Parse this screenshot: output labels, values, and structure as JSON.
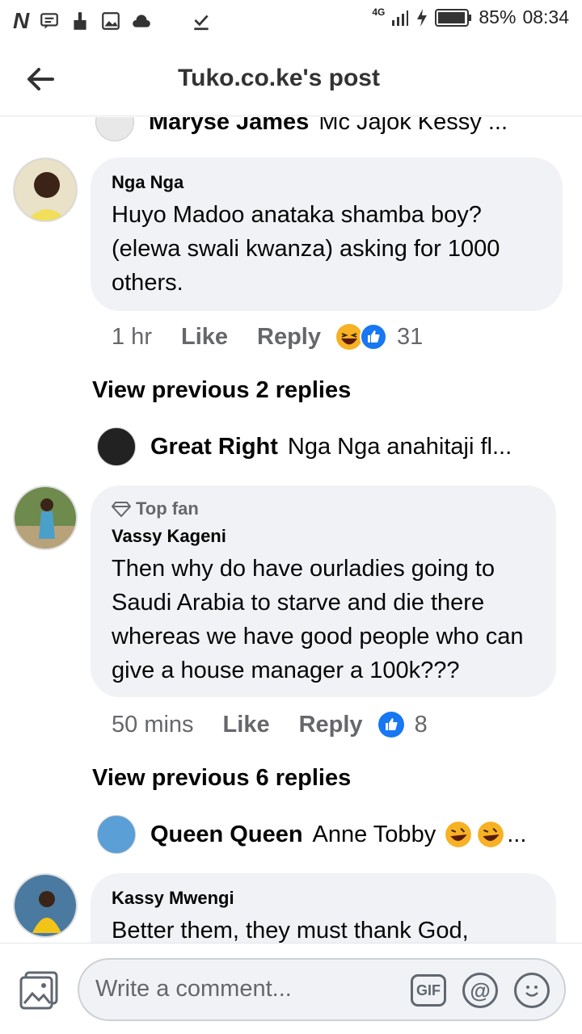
{
  "status_bar": {
    "network": "4G",
    "battery": "85%",
    "time": "08:34"
  },
  "header": {
    "title": "Tuko.co.ke's post"
  },
  "top_reply": {
    "name": "Maryse James",
    "preview": "Mc Jajok Kessy ..."
  },
  "comments": [
    {
      "author": "Nga Nga",
      "top_fan": false,
      "text": "Huyo Madoo anataka shamba boy? (elewa swali kwanza) asking for 1000 others.",
      "time": "1 hr",
      "like_label": "Like",
      "reply_label": "Reply",
      "reaction_count": "31",
      "reactions": [
        "haha-icon",
        "like-icon"
      ]
    },
    {
      "author": "Vassy Kageni",
      "top_fan": true,
      "top_fan_label": "Top fan",
      "text": "Then why  do have ourladies going to Saudi Arabia to starve and die there whereas we have good people who can give a house manager a 100k???",
      "time": "50 mins",
      "like_label": "Like",
      "reply_label": "Reply",
      "reaction_count": "8",
      "reactions": [
        "like-icon"
      ]
    },
    {
      "author": "Kassy Mwengi",
      "top_fan": false,
      "text": "Better them, they must thank God,"
    }
  ],
  "view_previous": [
    {
      "label": "View previous 2 replies"
    },
    {
      "label": "View previous 6 replies"
    }
  ],
  "reply_previews": [
    {
      "name": "Great Right",
      "preview": "Nga Nga anahitaji fl..."
    },
    {
      "name": "Queen Queen",
      "preview": "Anne Tobby"
    }
  ],
  "composer": {
    "placeholder": "Write a comment...",
    "gif_label": "GIF"
  },
  "colors": {
    "bubble": "#f0f2f5",
    "like_blue": "#1877f2",
    "secondary_text": "#65676b"
  }
}
